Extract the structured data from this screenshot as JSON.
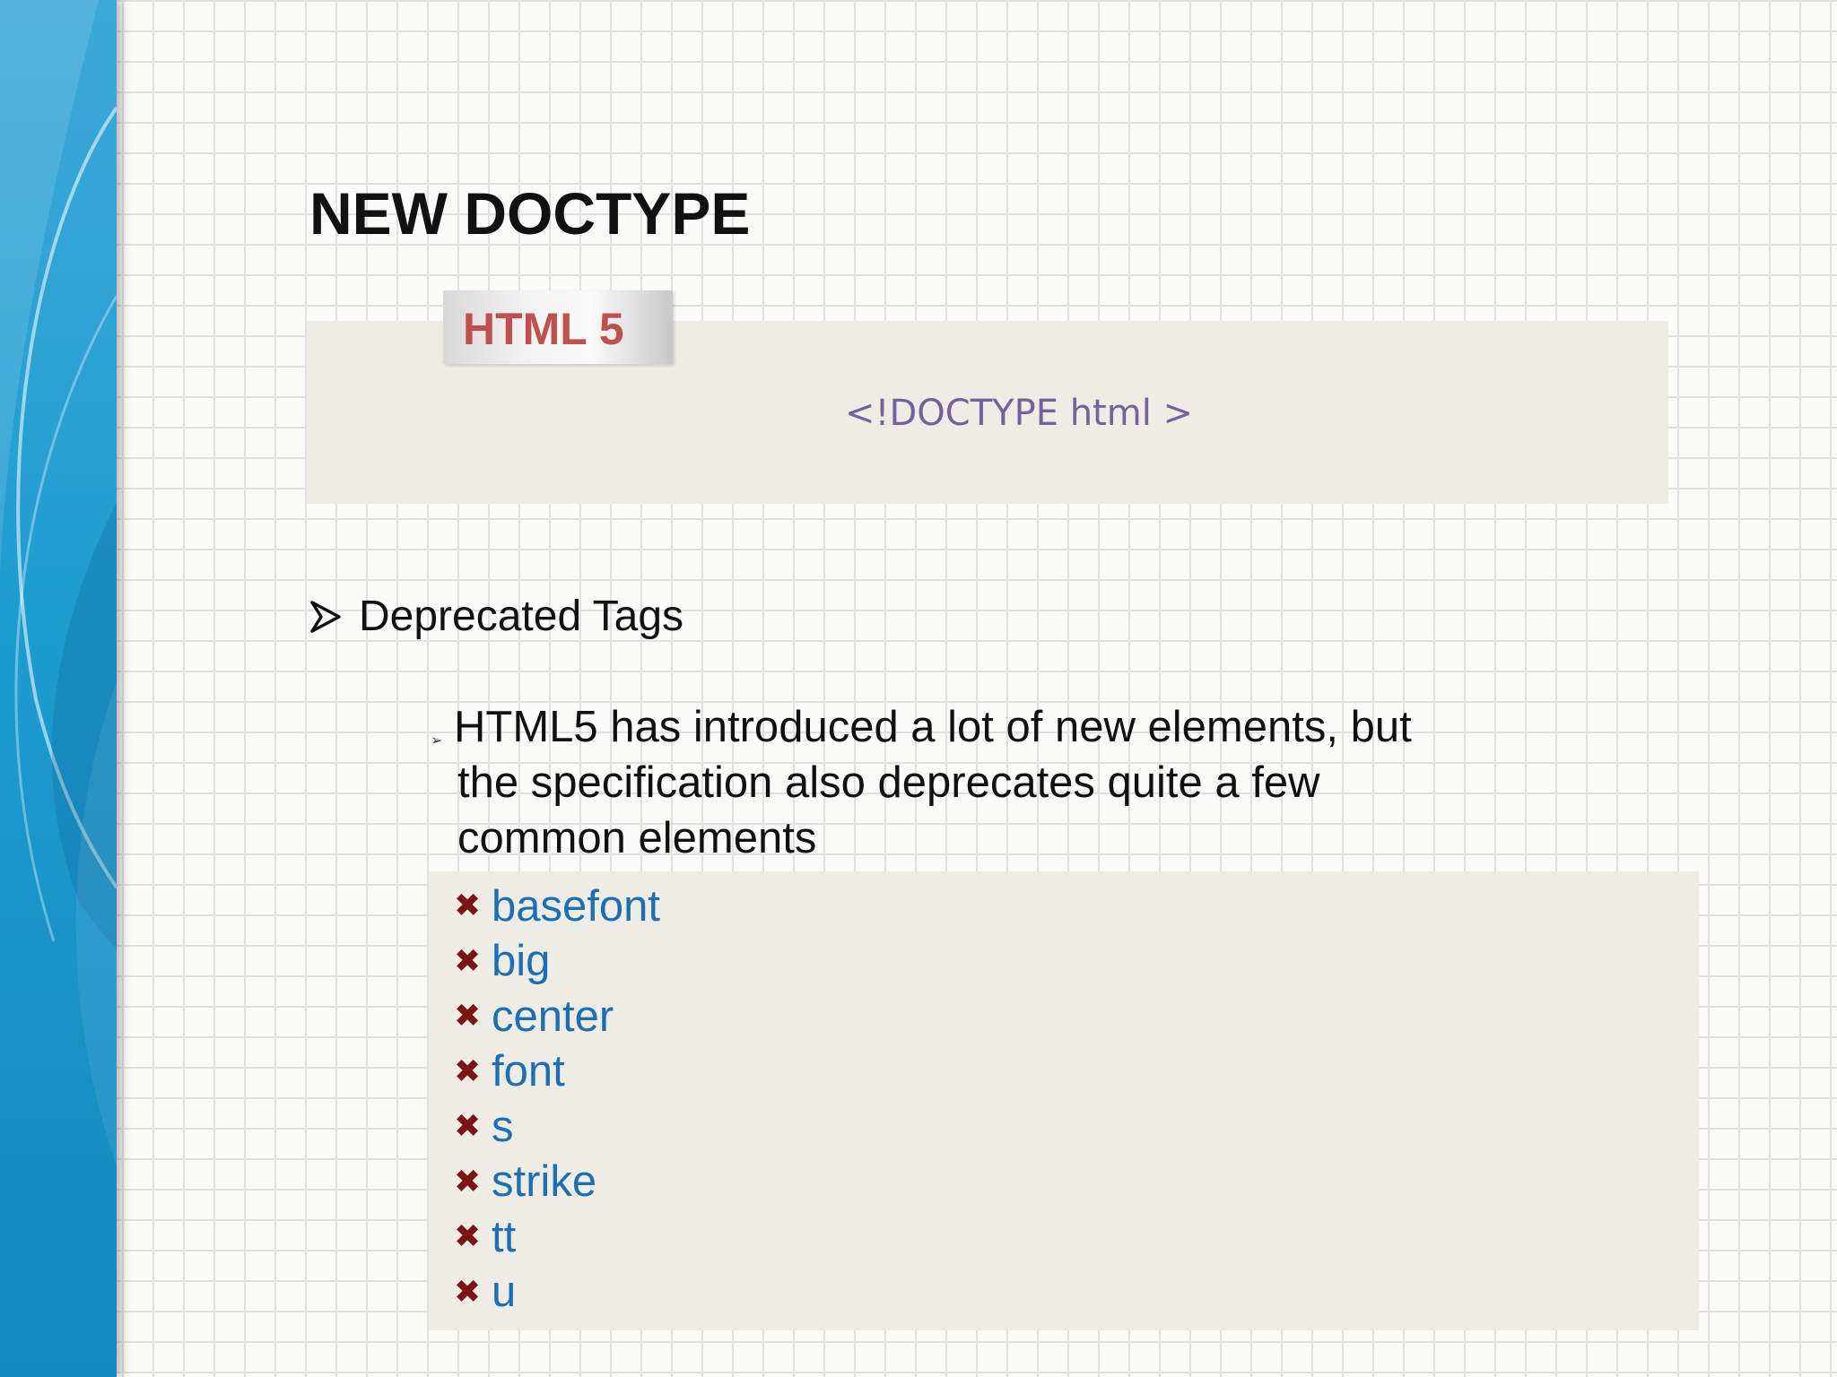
{
  "slide": {
    "title": "NEW DOCTYPE",
    "label_tab": "HTML 5",
    "code_text": "<!DOCTYPE html >",
    "bullet": "Deprecated Tags",
    "paragraph": "HTML5 has introduced a lot of new elements, but the specification also deprecates quite a few common elements",
    "deprecated_tags": [
      "basefont",
      "big",
      "center",
      "font",
      "s",
      "strike",
      "tt",
      "u"
    ],
    "icons": {
      "bullet": "arrow-bullet-icon",
      "tag_bullet": "x-mark-icon"
    },
    "colors": {
      "label": "#c0504d",
      "code": "#76629a",
      "tag": "#1a6fb5",
      "x_mark": "#7b1414",
      "band": "#1e9ccf"
    }
  }
}
